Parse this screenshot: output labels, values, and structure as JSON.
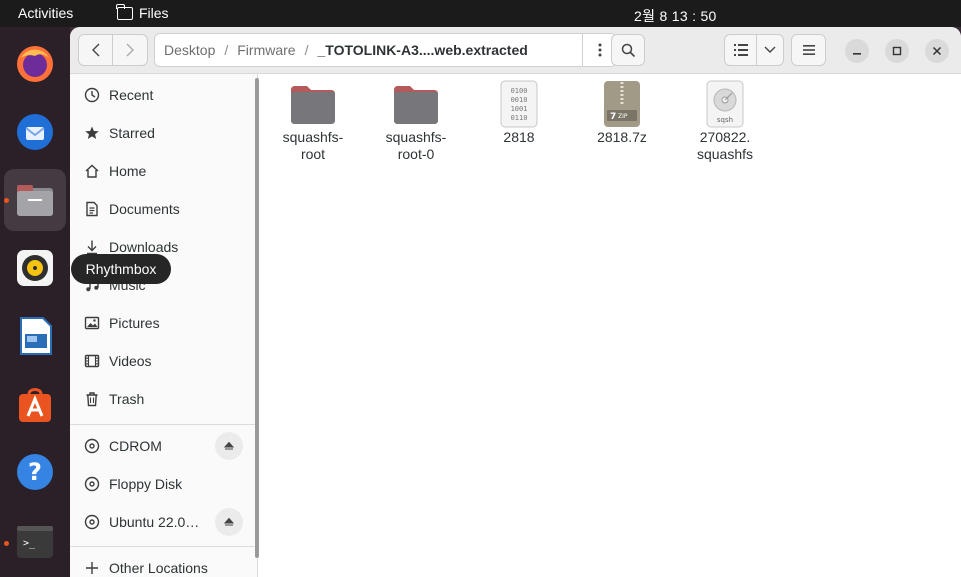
{
  "topbar": {
    "activities": "Activities",
    "app_name": "Files",
    "clock": "2월 8  13 : 50"
  },
  "dock": {
    "items": [
      {
        "name": "firefox-icon"
      },
      {
        "name": "thunderbird-icon"
      },
      {
        "name": "files-icon"
      },
      {
        "name": "rhythmbox-icon"
      },
      {
        "name": "libreoffice-writer-icon"
      },
      {
        "name": "app-center-icon"
      },
      {
        "name": "help-icon"
      },
      {
        "name": "terminal-icon"
      }
    ],
    "tooltip": "Rhythmbox"
  },
  "headerbar": {
    "path": [
      "Desktop",
      "Firmware",
      "_TOTOLINK-A3....web.extracted"
    ]
  },
  "sidebar": {
    "places": [
      {
        "label": "Recent",
        "icon": "clock-icon"
      },
      {
        "label": "Starred",
        "icon": "star-icon"
      },
      {
        "label": "Home",
        "icon": "home-icon"
      },
      {
        "label": "Documents",
        "icon": "document-icon"
      },
      {
        "label": "Downloads",
        "icon": "download-icon"
      },
      {
        "label": "Music",
        "icon": "music-icon"
      },
      {
        "label": "Pictures",
        "icon": "picture-icon"
      },
      {
        "label": "Videos",
        "icon": "video-icon"
      },
      {
        "label": "Trash",
        "icon": "trash-icon"
      }
    ],
    "devices": [
      {
        "label": "CDROM",
        "eject": true
      },
      {
        "label": "Floppy Disk",
        "eject": false
      },
      {
        "label": "Ubuntu 22.0…",
        "eject": true
      }
    ],
    "other": "Other Locations"
  },
  "files": [
    {
      "name": "squashfs-\nroot",
      "type": "folder"
    },
    {
      "name": "squashfs-\nroot-0",
      "type": "folder"
    },
    {
      "name": "2818",
      "type": "binary",
      "glyph": "0100\n0010\n1001\n0110"
    },
    {
      "name": "2818.7z",
      "type": "zip",
      "glyph": "ZIP"
    },
    {
      "name": "270822.\nsquashfs",
      "type": "disk-image",
      "glyph": "sqsh"
    }
  ],
  "colors": {
    "accent": "#e95420",
    "folder": "#77767b",
    "folder_tab": "#b55a5a"
  }
}
